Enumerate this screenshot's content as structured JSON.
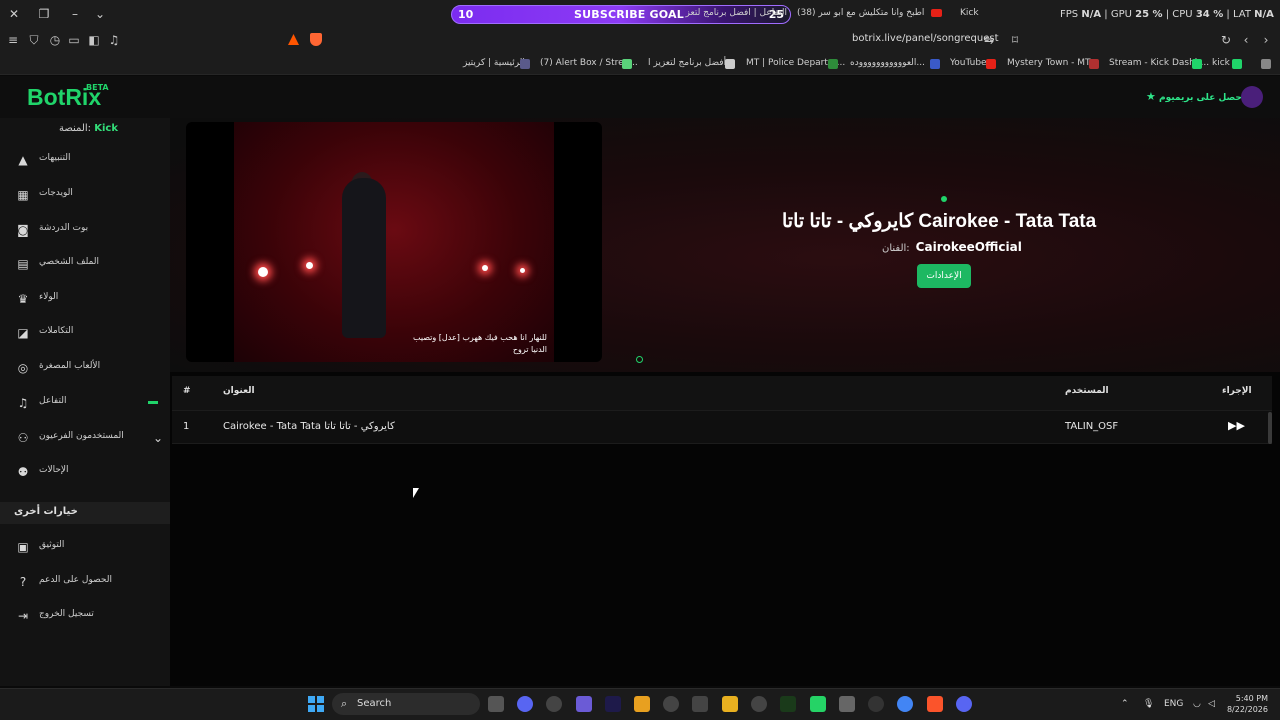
{
  "browser": {
    "goal_left": "10",
    "goal_label": "SUBSCRIBE GOAL",
    "goal_right": "25",
    "tab_title": "التفاعل | أفضل برنامج لتعز",
    "tab_title2": "(38) جربت اطبخ وانا متكليش مع ابو سر",
    "tab_kick": "Kick",
    "perf": {
      "fps_label": "FPS",
      "fps_value": "N/A",
      "gpu_label": "GPU",
      "gpu_value": "25 %",
      "cpu_label": "CPU",
      "cpu_value": "34 %",
      "lat_label": "LAT",
      "lat_value": "N/A"
    },
    "url": "botrix.live/panel/songrequest",
    "bookmarks": [
      "الرئيسية | كريتيز",
      "(7) Alert Box / Strea...",
      "أفضل برنامج لتعزيز ا...",
      "MT | Police Departm...",
      "العوووووووووووده...",
      "YouTube",
      "Mystery Town - MT...",
      "Stream - Kick Dashb...",
      "kick"
    ]
  },
  "app": {
    "logo": "BotRix",
    "beta": "BETA",
    "premium": "احصل على بريميوم",
    "platform_label": "المنصة:",
    "platform_value": "Kick",
    "nav": [
      "التنبيهات",
      "الويدجات",
      "بوت الدردشة",
      "الملف الشخصي",
      "الولاء",
      "التكاملات",
      "الألعاب المصغرة",
      "التفاعل",
      "المستخدمون الفرعيون",
      "الإحالات"
    ],
    "other_section": "خيارات أخرى",
    "other_nav": [
      "التوثيق",
      "الحصول على الدعم",
      "تسجيل الخروج"
    ]
  },
  "player": {
    "subtitle": "للنهار انا هحب فيك ههرب [عدل] وتصيب الدنيا تروح",
    "song_title": "كايروكي - تاتا تاتا Cairokee - Tata Tata",
    "artist_label": "الفنان:",
    "artist": "CairokeeOfficial",
    "settings": "الإعدادات"
  },
  "table": {
    "headers": {
      "num": "#",
      "title": "العنوان",
      "user": "المستخدم",
      "action": "الإجراء"
    },
    "rows": [
      {
        "num": "1",
        "title": "Cairokee - Tata Tata كايروكي - تاتا تاتا",
        "user": "TALIN_OSF"
      }
    ]
  },
  "taskbar": {
    "search": "Search",
    "lang": "ENG",
    "time": "5:40 PM",
    "date": "8/22/2026"
  },
  "colors": {
    "accent": "#20d46a",
    "goal": "#8d3bf5"
  }
}
